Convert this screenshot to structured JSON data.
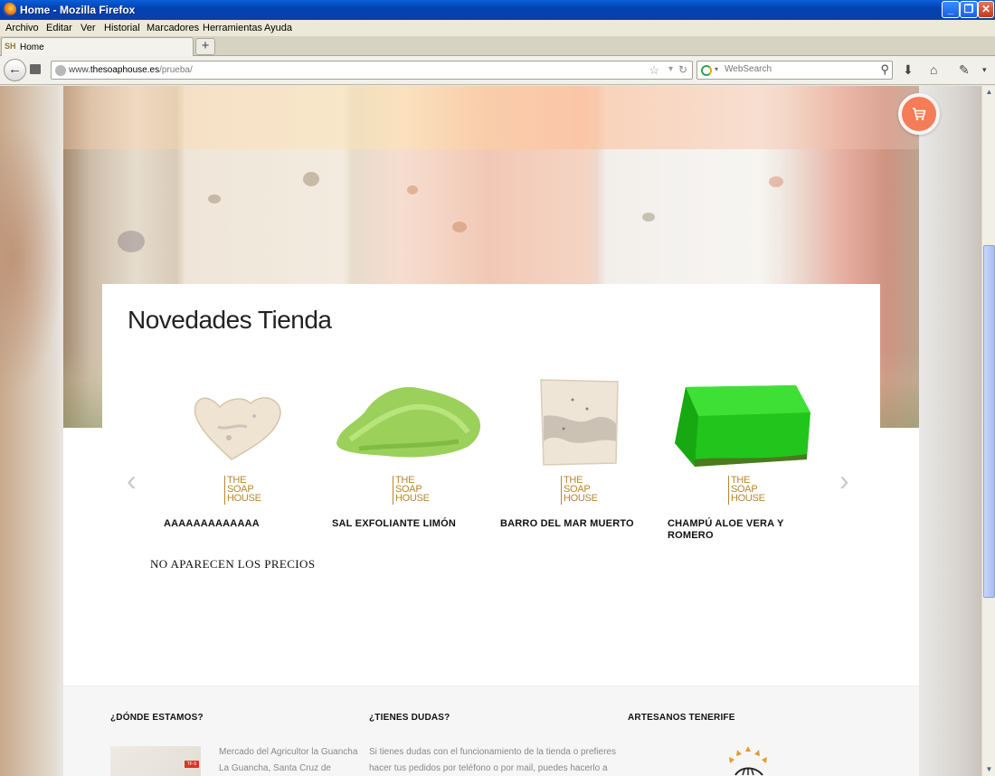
{
  "window": {
    "title": "Home - Mozilla Firefox",
    "minimize": "_",
    "restore": "❐",
    "close": "✕"
  },
  "menu": [
    "Archivo",
    "Editar",
    "Ver",
    "Historial",
    "Marcadores",
    "Herramientas",
    "Ayuda"
  ],
  "tab": {
    "favicon": "SH",
    "label": "Home",
    "new_tab": "+"
  },
  "nav": {
    "back": "←",
    "url_host": "www.",
    "url_domain": "thesoaphouse.es",
    "url_path": "/prueba/",
    "search_placeholder": "WebSearch"
  },
  "page": {
    "section_title": "Novedades Tienda",
    "prev_arrow": "‹",
    "next_arrow": "›",
    "logo_text": [
      "THE",
      "SOAP",
      "HOUSE"
    ],
    "products": [
      {
        "name": "AAAAAAAAAAAAA",
        "image": "heart-soap"
      },
      {
        "name": "SAL EXFOLIANTE LIMÓN",
        "image": "green-salt"
      },
      {
        "name": "BARRO DEL MAR MUERTO",
        "image": "white-soap-bar"
      },
      {
        "name": "CHAMPÚ ALOE VERA Y ROMERO",
        "image": "green-glycerin-soap"
      }
    ],
    "note": "NO APARECEN LOS PRECIOS"
  },
  "footer": {
    "col1_title": "¿DÓNDE ESTAMOS?",
    "col1_text": "Mercado del Agricultor la Guancha La Guancha, Santa Cruz de",
    "map_pin": "TF-5",
    "col2_title": "¿TIENES DUDAS?",
    "col2_text": "Si tienes dudas con el funcionamiento de la tienda o prefieres hacer tus pedidos por teléfono o por mail, puedes hacerlo a",
    "col3_title": "ARTESANOS TENERIFE"
  },
  "colors": {
    "accent_cart": "#f47d58",
    "logo_gold": "#b8862e",
    "xp_title_blue": "#0243b4"
  },
  "icons": {
    "cart": "shopping-cart-icon",
    "star": "bookmark-star-icon",
    "reload": "reload-icon",
    "search": "magnifier-icon",
    "download": "download-arrow-icon",
    "home": "home-icon"
  }
}
